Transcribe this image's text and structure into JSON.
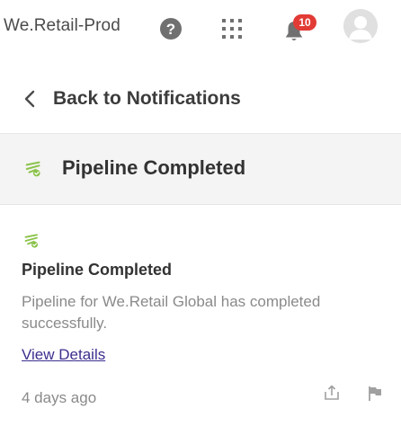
{
  "header": {
    "app_title": "We.Retail-Prod",
    "notification_count": "10",
    "icons": {
      "help": "help-icon",
      "apps": "apps-grid-icon",
      "notifications": "bell-icon",
      "user": "avatar"
    },
    "colors": {
      "badge": "#e23a35",
      "icon": "#6e6e6e"
    }
  },
  "back": {
    "label": "Back to Notifications"
  },
  "detail": {
    "title": "Pipeline Completed",
    "icon": "pipeline-icon",
    "icon_color": "#8bc34a"
  },
  "notification": {
    "title": "Pipeline Completed",
    "description": "Pipeline for We.Retail Global has completed successfully.",
    "link_label": "View Details",
    "timestamp": "4 days ago",
    "actions": [
      "share-icon",
      "flag-icon"
    ],
    "link_color": "#3b2f8f"
  }
}
